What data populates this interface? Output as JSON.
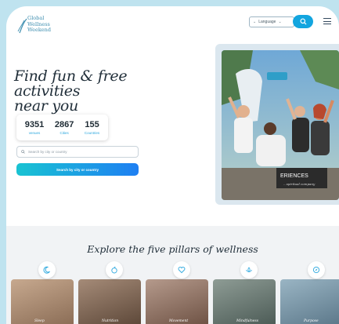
{
  "header": {
    "logo_lines": [
      "Global",
      "Wellness",
      "Weekend"
    ],
    "language_label": "Language",
    "icons": {
      "language_caret": "chevron-down-icon",
      "search": "search-icon",
      "menu": "hamburger-menu-icon"
    }
  },
  "hero": {
    "headline_line1": "Find fun & free activities",
    "headline_line2": "near you",
    "stats": [
      {
        "value": "9351",
        "label": "venues"
      },
      {
        "value": "2867",
        "label": "Cities"
      },
      {
        "value": "155",
        "label": "Countries"
      }
    ],
    "search_placeholder": "Search by city or country",
    "cta_label": "Search by city or country",
    "photo_sign_text": "ERIENCES",
    "photo_sign_sub": "...spiritual company"
  },
  "pillars": {
    "title": "Explore the five pillars of wellness",
    "items": [
      {
        "label": "Sleep",
        "icon": "moon-icon",
        "color": "#9b7b63"
      },
      {
        "label": "Nutrition",
        "icon": "apple-icon",
        "color": "#7a5e4a"
      },
      {
        "label": "Movement",
        "icon": "heart-pulse-icon",
        "color": "#8a6a5a"
      },
      {
        "label": "Mindfulness",
        "icon": "lotus-icon",
        "color": "#5f6f6a"
      },
      {
        "label": "Purpose",
        "icon": "compass-icon",
        "color": "#6f8fa0"
      }
    ]
  },
  "colors": {
    "accent_blue": "#12a5df",
    "gradient_start": "#19c3d2",
    "gradient_end": "#1e7ff2",
    "page_frame": "#bfe3ef"
  }
}
